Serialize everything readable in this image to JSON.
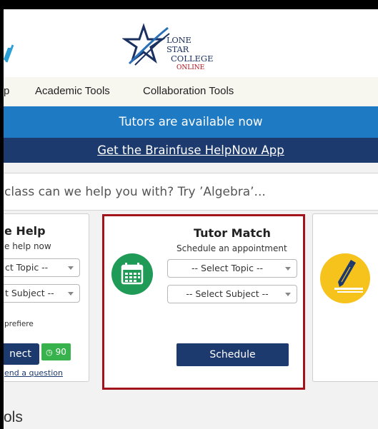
{
  "logo": {
    "line1": "LONE STAR",
    "line2": "COLLEGE",
    "line3": "ONLINE"
  },
  "nav": {
    "items": [
      {
        "label": "p"
      },
      {
        "label": "Academic Tools"
      },
      {
        "label": "Collaboration Tools"
      }
    ]
  },
  "banners": {
    "tutors": "Tutors are available now",
    "app": "Get the Brainfuse HelpNow App"
  },
  "search": {
    "placeholder": "class can we help you with? Try ’Algebra’..."
  },
  "cards": {
    "live": {
      "title": "e Help",
      "subtitle": "e help now",
      "topic_select": "ct Topic --",
      "subject_select": "t Subject --",
      "note": "prefiere",
      "connect_label": "nect",
      "timer": "90",
      "link": "end a question"
    },
    "match": {
      "title": "Tutor Match",
      "subtitle": "Schedule an appointment",
      "topic_select": "-- Select Topic --",
      "subject_select": "-- Select Subject --",
      "schedule_label": "Schedule"
    }
  },
  "tools_heading": "ols",
  "colors": {
    "nav_bg": "#f7f6ef",
    "banner_blue": "#1f7ac4",
    "banner_navy": "#1c3a6e",
    "highlight_red": "#a3131c",
    "calendar_green": "#1f9a57",
    "pencil_yellow": "#f6c21c",
    "timer_green": "#37b24d"
  }
}
